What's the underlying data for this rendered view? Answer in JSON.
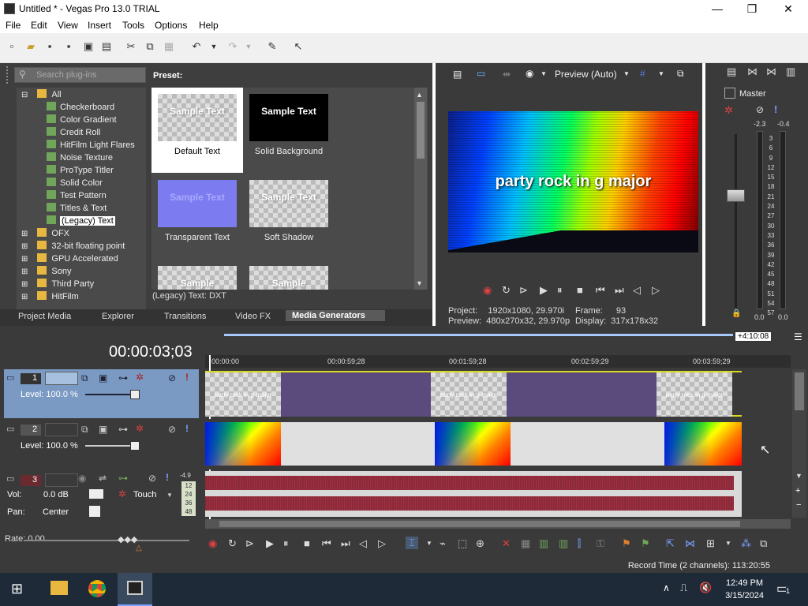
{
  "window": {
    "title": "Untitled * - Vegas Pro 13.0 TRIAL",
    "minimize": "—",
    "maximize": "❐",
    "close": "✕"
  },
  "menu": [
    "File",
    "Edit",
    "View",
    "Insert",
    "Tools",
    "Options",
    "Help"
  ],
  "plugins": {
    "search_placeholder": "Search plug-ins",
    "tree": [
      {
        "label": "All",
        "type": "folder",
        "expanded": true
      },
      {
        "label": "Checkerboard",
        "type": "fx"
      },
      {
        "label": "Color Gradient",
        "type": "fx"
      },
      {
        "label": "Credit Roll",
        "type": "fx"
      },
      {
        "label": "HitFilm Light Flares",
        "type": "fx"
      },
      {
        "label": "Noise Texture",
        "type": "fx"
      },
      {
        "label": "ProType Titler",
        "type": "fx"
      },
      {
        "label": "Solid Color",
        "type": "fx"
      },
      {
        "label": "Test Pattern",
        "type": "fx"
      },
      {
        "label": "Titles & Text",
        "type": "fx"
      },
      {
        "label": "(Legacy) Text",
        "type": "fx",
        "selected": true
      },
      {
        "label": "OFX",
        "type": "folder"
      },
      {
        "label": "32-bit floating point",
        "type": "folder"
      },
      {
        "label": "GPU Accelerated",
        "type": "folder"
      },
      {
        "label": "Sony",
        "type": "folder"
      },
      {
        "label": "Third Party",
        "type": "folder"
      },
      {
        "label": "HitFilm",
        "type": "folder"
      }
    ],
    "preset_header": "Preset:",
    "presets": [
      {
        "name": "Default Text",
        "thumb_text": "Sample Text",
        "style": "checker",
        "selected": true
      },
      {
        "name": "Solid Background",
        "thumb_text": "Sample Text",
        "style": "black"
      },
      {
        "name": "Transparent Text",
        "thumb_text": "Sample Text",
        "style": "purple"
      },
      {
        "name": "Soft Shadow",
        "thumb_text": "Sample Text",
        "style": "checker"
      },
      {
        "name": "",
        "thumb_text": "Sample",
        "style": "checker"
      },
      {
        "name": "",
        "thumb_text": "Sample",
        "style": "checker"
      }
    ],
    "status": "(Legacy) Text: DXT"
  },
  "tabs": [
    {
      "label": "Project Media",
      "active": false
    },
    {
      "label": "Explorer",
      "active": false
    },
    {
      "label": "Transitions",
      "active": false
    },
    {
      "label": "Video FX",
      "active": false
    },
    {
      "label": "Media Generators",
      "active": true
    }
  ],
  "preview": {
    "mode": "Preview (Auto)",
    "video_caption": "party rock in g major",
    "project_label": "Project:",
    "project_value": "1920x1080, 29.970i",
    "preview_label": "Preview:",
    "preview_value": "480x270x32, 29.970p",
    "frame_label": "Frame:",
    "frame_value": "93",
    "display_label": "Display:",
    "display_value": "317x178x32"
  },
  "mixer": {
    "label": "Master",
    "peak_left": "-2.3",
    "peak_right": "-0.4",
    "scale": [
      "3",
      "6",
      "9",
      "12",
      "15",
      "18",
      "21",
      "24",
      "27",
      "30",
      "33",
      "36",
      "39",
      "42",
      "45",
      "48",
      "51",
      "54",
      "57"
    ],
    "level_left": "0.0",
    "level_right": "0.0"
  },
  "timeline": {
    "timecode": "00:00:03;03",
    "duration_badge": "+4:10:08",
    "ruler": [
      "00:00:00",
      "00:00:59;28",
      "00:01:59;28",
      "00:02:59;29",
      "00:03:59;29"
    ],
    "tracks": [
      {
        "num": "1",
        "level_label": "Level: 100.0 %",
        "type": "video"
      },
      {
        "num": "2",
        "level_label": "Level: 100.0 %",
        "type": "video"
      },
      {
        "num": "3",
        "type": "audio",
        "vol_label": "Vol:",
        "vol_value": "0.0 dB",
        "pan_label": "Pan:",
        "pan_value": "Center",
        "mode": "Touch",
        "meter_top": "-4.9",
        "meter_vals": [
          "12",
          "24",
          "36",
          "48"
        ]
      }
    ],
    "clip_text": "party rock in g major",
    "rate": "Rate: 0.00"
  },
  "status": {
    "record_time": "Record Time (2 channels): 113:20:55"
  },
  "taskbar": {
    "time": "12:49 PM",
    "date": "3/15/2024",
    "notification_count": "1"
  }
}
